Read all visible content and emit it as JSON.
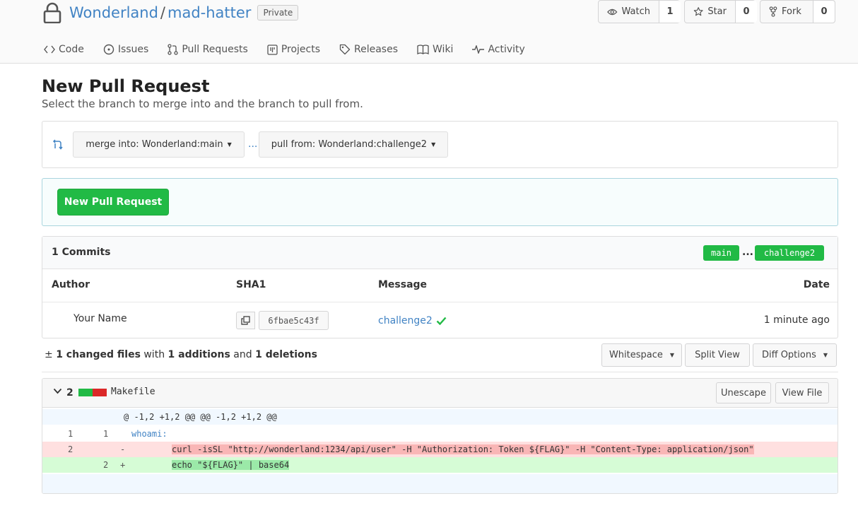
{
  "repo": {
    "owner": "Wonderland",
    "slash": "/",
    "name": "mad-hatter",
    "visibility": "Private",
    "actions": [
      {
        "label": "Watch",
        "count": "1",
        "icon": "eye-icon"
      },
      {
        "label": "Star",
        "count": "0",
        "icon": "star-icon"
      },
      {
        "label": "Fork",
        "count": "0",
        "icon": "fork-icon"
      }
    ],
    "tabs": [
      {
        "label": "Code",
        "icon": "code-icon"
      },
      {
        "label": "Issues",
        "icon": "issue-icon"
      },
      {
        "label": "Pull Requests",
        "icon": "pull-request-icon"
      },
      {
        "label": "Projects",
        "icon": "project-icon"
      },
      {
        "label": "Releases",
        "icon": "tag-icon"
      },
      {
        "label": "Wiki",
        "icon": "book-icon"
      },
      {
        "label": "Activity",
        "icon": "pulse-icon"
      }
    ]
  },
  "page": {
    "title": "New Pull Request",
    "subtitle": "Select the branch to merge into and the branch to pull from."
  },
  "branches": {
    "merge_into": "merge into: Wonderland:main",
    "dots": "...",
    "pull_from": "pull from: Wonderland:challenge2"
  },
  "compare": {
    "button_label": "New Pull Request"
  },
  "commits": {
    "count_label": "1 Commits",
    "base_branch": "main",
    "dots": "...",
    "head_branch": "challenge2",
    "columns": {
      "author": "Author",
      "sha": "SHA1",
      "message": "Message",
      "date": "Date"
    },
    "rows": [
      {
        "author": "Your Name",
        "sha": "6fbae5c43f",
        "message": "challenge2",
        "date": "1 minute ago"
      }
    ]
  },
  "diff": {
    "stats": {
      "files_count": "1 changed files",
      "with": "with",
      "additions": "1 additions",
      "and": "and",
      "deletions": "1 deletions"
    },
    "buttons": {
      "whitespace": "Whitespace",
      "split_view": "Split View",
      "diff_options": "Diff Options"
    },
    "file": {
      "changes": "2",
      "name": "Makefile",
      "unescape": "Unescape",
      "view_file": "View File",
      "hunk": "@ -1,2 +1,2 @@ @@ -1,2 +1,2 @@",
      "lines": [
        {
          "old": "1",
          "new": "1",
          "sign": "",
          "code": "whoami:"
        },
        {
          "old": "2",
          "new": "",
          "sign": "-",
          "code": "curl -isSL \"http://wonderland:1234/api/user\" -H \"Authorization: Token ${FLAG}\" -H \"Content-Type: application/json\""
        },
        {
          "old": "",
          "new": "2",
          "sign": "+",
          "code": "echo \"${FLAG}\" | base64"
        }
      ]
    }
  },
  "colors": {
    "accent": "#4183c4",
    "green": "#21ba45",
    "red": "#db2828"
  }
}
